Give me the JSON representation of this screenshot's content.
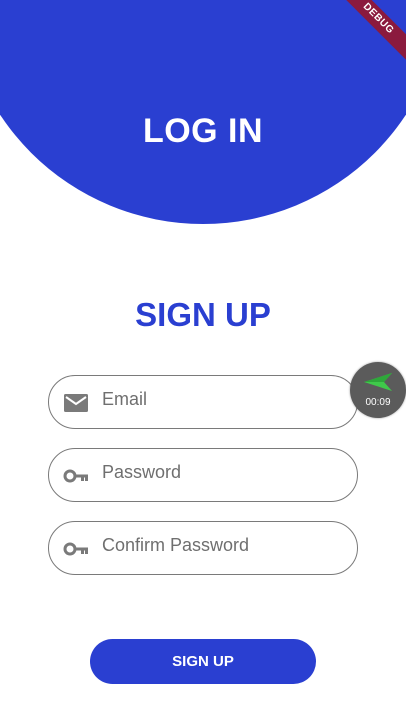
{
  "header": {
    "title": "LOG IN",
    "debug_label": "DEBUG"
  },
  "form": {
    "title": "SIGN UP",
    "email_placeholder": "Email",
    "password_placeholder": "Password",
    "confirm_placeholder": "Confirm Password",
    "submit_label": "SIGN UP"
  },
  "recorder": {
    "time": "00:09",
    "icon": "send-arrow-icon"
  },
  "icons": {
    "email": "mail-icon",
    "password": "key-icon",
    "confirm": "key-icon"
  },
  "colors": {
    "primary": "#2a3fd1",
    "debug_ribbon": "#8b1a3e",
    "recorder_bg": "#5b5b5b",
    "recorder_arrow": "#3fc94a",
    "icon_gray": "#7a7a7a"
  }
}
